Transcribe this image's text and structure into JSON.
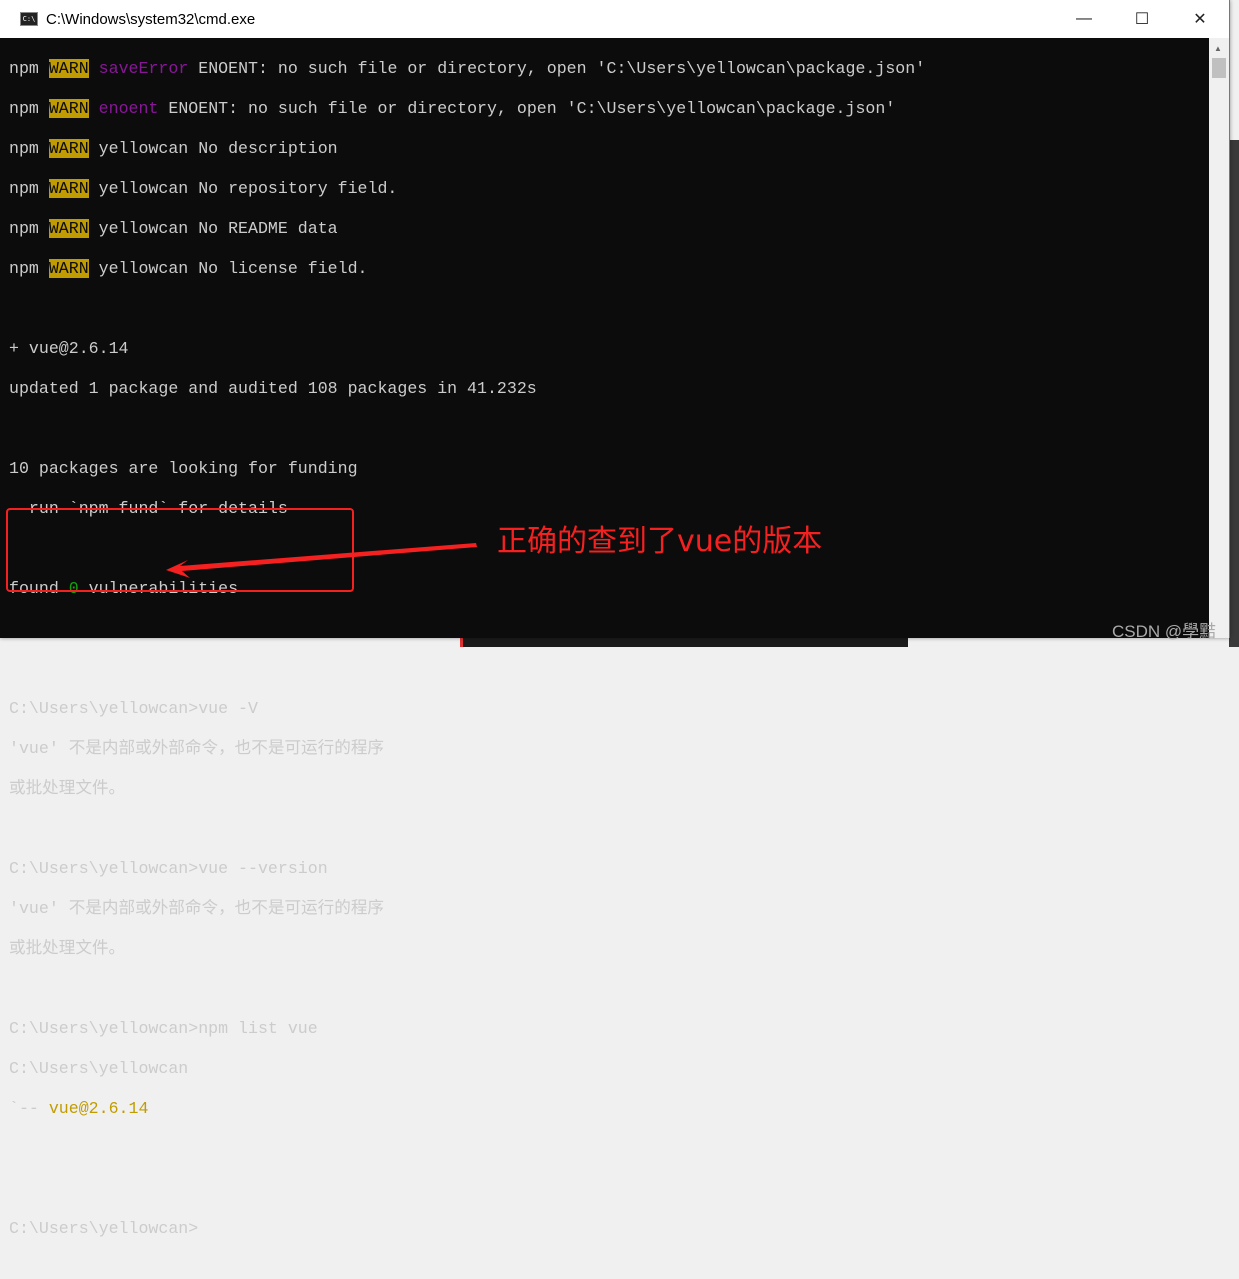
{
  "window": {
    "title": "C:\\Windows\\system32\\cmd.exe",
    "icon": "cmd-icon",
    "controls": [
      "minimize",
      "maximize",
      "close"
    ]
  },
  "console": {
    "warn_lines": [
      {
        "prefix": "npm ",
        "tag": "WARN",
        "key": "saveError",
        "text": " ENOENT: no such file or directory, open 'C:\\Users\\yellowcan\\package.json'"
      },
      {
        "prefix": "npm ",
        "tag": "WARN",
        "key": "enoent",
        "text": " ENOENT: no such file or directory, open 'C:\\Users\\yellowcan\\package.json'"
      },
      {
        "prefix": "npm ",
        "tag": "WARN",
        "key": "",
        "text": " yellowcan No description"
      },
      {
        "prefix": "npm ",
        "tag": "WARN",
        "key": "",
        "text": " yellowcan No repository field."
      },
      {
        "prefix": "npm ",
        "tag": "WARN",
        "key": "",
        "text": " yellowcan No README data"
      },
      {
        "prefix": "npm ",
        "tag": "WARN",
        "key": "",
        "text": " yellowcan No license field."
      }
    ],
    "added": "+ vue@2.6.14",
    "updated": "updated 1 package and audited 108 packages in 41.232s",
    "funding1": "10 packages are looking for funding",
    "funding2": "  run `npm fund` for details",
    "found_pre": "found ",
    "found_num": "0",
    "found_post": " vulnerabilities",
    "cmd1": "C:\\Users\\yellowcan>vue -V",
    "err1a": "'vue' 不是内部或外部命令，也不是可运行的程序",
    "err1b": "或批处理文件。",
    "cmd2": "C:\\Users\\yellowcan>vue --version",
    "err2a": "'vue' 不是内部或外部命令，也不是可运行的程序",
    "err2b": "或批处理文件。",
    "cmd3": "C:\\Users\\yellowcan>npm list vue",
    "tree_root": "C:\\Users\\yellowcan",
    "tree_branch": "`-- ",
    "tree_pkg": "vue@2.6.14",
    "prompt": "C:\\Users\\yellowcan>"
  },
  "annotation": {
    "text": "正确的查到了vue的版本",
    "color": "#f52020"
  },
  "watermark": "CSDN @學黠"
}
